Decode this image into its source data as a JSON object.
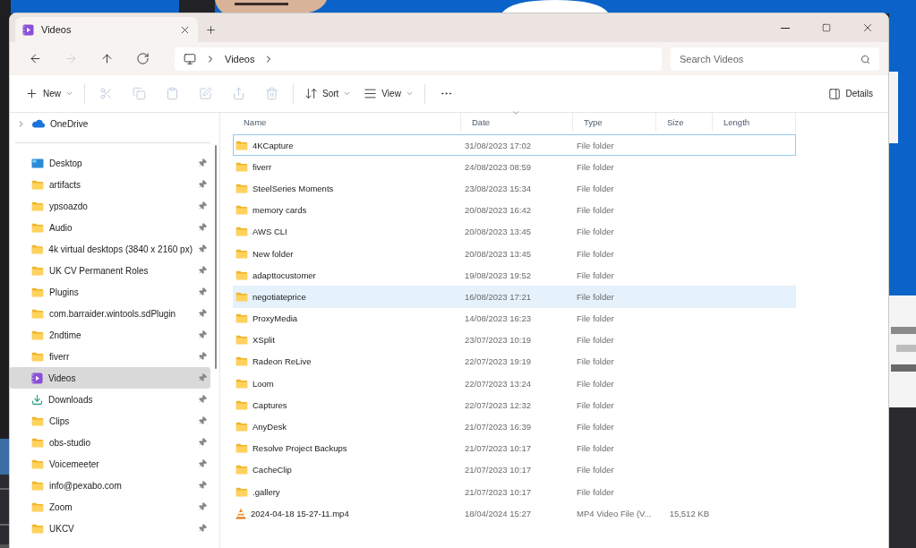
{
  "tab": {
    "title": "Videos",
    "selected": true
  },
  "nav": [
    {
      "kind": "back",
      "disabled": false
    },
    {
      "kind": "forward",
      "disabled": true
    },
    {
      "kind": "up",
      "disabled": false
    },
    {
      "kind": "refresh",
      "disabled": false
    }
  ],
  "address": {
    "crumbs": [
      "Videos"
    ]
  },
  "search": {
    "placeholder": "Search Videos"
  },
  "commands": [
    {
      "kind": "new",
      "label": "New",
      "disabled": false
    },
    {
      "kind": "cut",
      "disabled": true
    },
    {
      "kind": "copy",
      "disabled": true
    },
    {
      "kind": "paste",
      "disabled": true
    },
    {
      "kind": "rename",
      "disabled": true
    },
    {
      "kind": "share",
      "disabled": true
    },
    {
      "kind": "delete",
      "disabled": true
    },
    {
      "kind": "sort",
      "label": "Sort",
      "disabled": false
    },
    {
      "kind": "view",
      "label": "View",
      "disabled": false
    },
    {
      "kind": "more",
      "disabled": false
    }
  ],
  "details": {
    "label": "Details"
  },
  "sidebar": {
    "top": [
      {
        "label": "OneDrive",
        "kind": "cloud",
        "expanded": false
      }
    ],
    "items": [
      {
        "label": "Desktop",
        "kind": "desktop",
        "selected": false,
        "pinned": true
      },
      {
        "label": "artifacts",
        "kind": "folder",
        "selected": false,
        "pinned": true
      },
      {
        "label": "ypsoazdo",
        "kind": "folder",
        "selected": false,
        "pinned": true
      },
      {
        "label": "Audio",
        "kind": "folder",
        "selected": false,
        "pinned": true
      },
      {
        "label": "4k virtual desktops (3840 x 2160 px)",
        "kind": "folder",
        "selected": false,
        "pinned": true
      },
      {
        "label": "UK CV Permanent Roles",
        "kind": "folder",
        "selected": false,
        "pinned": true
      },
      {
        "label": "Plugins",
        "kind": "folder",
        "selected": false,
        "pinned": true
      },
      {
        "label": "com.barraider.wintools.sdPlugin",
        "kind": "folder",
        "selected": false,
        "pinned": true
      },
      {
        "label": "2ndtime",
        "kind": "folder",
        "selected": false,
        "pinned": true
      },
      {
        "label": "fiverr",
        "kind": "folder",
        "selected": false,
        "pinned": true
      },
      {
        "label": "Videos",
        "kind": "videos",
        "selected": true,
        "pinned": true
      },
      {
        "label": "Downloads",
        "kind": "download",
        "selected": false,
        "pinned": true
      },
      {
        "label": "Clips",
        "kind": "folder",
        "selected": false,
        "pinned": true
      },
      {
        "label": "obs-studio",
        "kind": "folder",
        "selected": false,
        "pinned": true
      },
      {
        "label": "Voicemeeter",
        "kind": "folder",
        "selected": false,
        "pinned": true
      },
      {
        "label": "info@pexabo.com",
        "kind": "folder",
        "selected": false,
        "pinned": true
      },
      {
        "label": "Zoom",
        "kind": "folder",
        "selected": false,
        "pinned": true
      },
      {
        "label": "UKCV",
        "kind": "folder",
        "selected": false,
        "pinned": true
      }
    ]
  },
  "columns": [
    {
      "label": "Name",
      "sorted": false
    },
    {
      "label": "Date",
      "sorted": true
    },
    {
      "label": "Type",
      "sorted": false
    },
    {
      "label": "Size",
      "sorted": false
    },
    {
      "label": "Length",
      "sorted": false
    }
  ],
  "rows": [
    {
      "name": "4KCapture",
      "date": "31/08/2023 17:02",
      "type": "File folder",
      "kind": "folder",
      "selected": false,
      "focused": true
    },
    {
      "name": "fiverr",
      "date": "24/08/2023 08:59",
      "type": "File folder",
      "kind": "folder",
      "selected": false,
      "focused": false
    },
    {
      "name": "SteelSeries Moments",
      "date": "23/08/2023 15:34",
      "type": "File folder",
      "kind": "folder",
      "selected": false,
      "focused": false
    },
    {
      "name": "memory cards",
      "date": "20/08/2023 16:42",
      "type": "File folder",
      "kind": "folder",
      "selected": false,
      "focused": false
    },
    {
      "name": "AWS CLI",
      "date": "20/08/2023 13:45",
      "type": "File folder",
      "kind": "folder",
      "selected": false,
      "focused": false
    },
    {
      "name": "New folder",
      "date": "20/08/2023 13:45",
      "type": "File folder",
      "kind": "folder",
      "selected": false,
      "focused": false
    },
    {
      "name": "adapttocustomer",
      "date": "19/08/2023 19:52",
      "type": "File folder",
      "kind": "folder",
      "selected": false,
      "focused": false
    },
    {
      "name": "negotiateprice",
      "date": "16/08/2023 17:21",
      "type": "File folder",
      "kind": "folder",
      "selected": true,
      "focused": false
    },
    {
      "name": "ProxyMedia",
      "date": "14/08/2023 16:23",
      "type": "File folder",
      "kind": "folder",
      "selected": false,
      "focused": false
    },
    {
      "name": "XSplit",
      "date": "23/07/2023 10:19",
      "type": "File folder",
      "kind": "folder",
      "selected": false,
      "focused": false
    },
    {
      "name": "Radeon ReLive",
      "date": "22/07/2023 19:19",
      "type": "File folder",
      "kind": "folder",
      "selected": false,
      "focused": false
    },
    {
      "name": "Loom",
      "date": "22/07/2023 13:24",
      "type": "File folder",
      "kind": "folder",
      "selected": false,
      "focused": false
    },
    {
      "name": "Captures",
      "date": "22/07/2023 12:32",
      "type": "File folder",
      "kind": "folder",
      "selected": false,
      "focused": false
    },
    {
      "name": "AnyDesk",
      "date": "21/07/2023 16:39",
      "type": "File folder",
      "kind": "folder",
      "selected": false,
      "focused": false
    },
    {
      "name": "Resolve Project Backups",
      "date": "21/07/2023 10:17",
      "type": "File folder",
      "kind": "folder",
      "selected": false,
      "focused": false
    },
    {
      "name": "CacheClip",
      "date": "21/07/2023 10:17",
      "type": "File folder",
      "kind": "folder",
      "selected": false,
      "focused": false
    },
    {
      "name": ".gallery",
      "date": "21/07/2023 10:17",
      "type": "File folder",
      "kind": "folder",
      "selected": false,
      "focused": false
    },
    {
      "name": "2024-04-18 15-27-11.mp4",
      "date": "18/04/2024 15:27",
      "type": "MP4 Video File (V...",
      "size": "15,512 KB",
      "kind": "video",
      "selected": false,
      "focused": false
    }
  ]
}
